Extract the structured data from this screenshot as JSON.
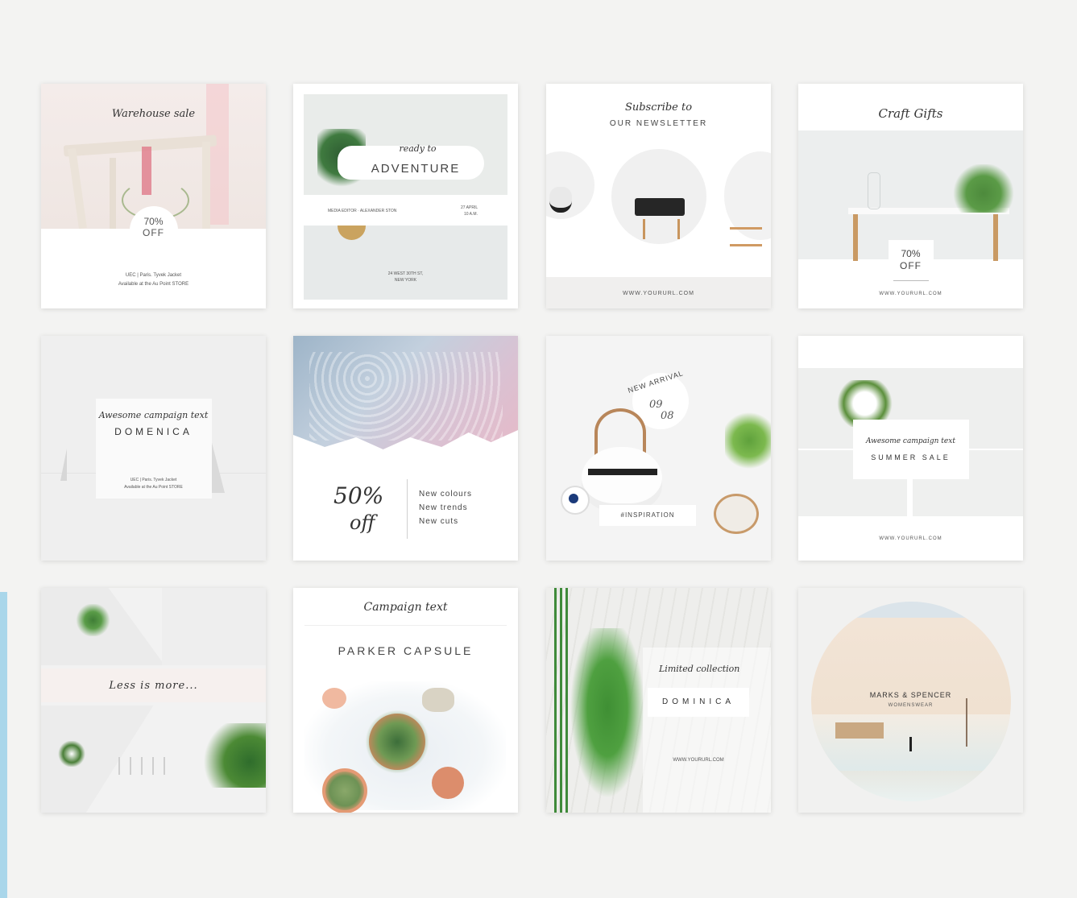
{
  "colors": {
    "background": "#f3f3f2",
    "accent_strip": "#a9d6ea",
    "card": "#ffffff"
  },
  "cards": [
    {
      "script": "Warehouse sale",
      "badge_line1": "70%",
      "badge_line2": "OFF",
      "caption_line1": "UEC | Paris. Tyvek Jacket",
      "caption_line2": "Available at the Au Point STORE"
    },
    {
      "script": "ready to",
      "heading": "ADVENTURE",
      "meta_left": "MEDIA EDITOR  ·  ALEXANDER STON",
      "meta_date": "27 APRIL",
      "meta_time": "10 A.M.",
      "address_line1": "24 WEST 30TH ST,",
      "address_line2": "NEW YORK"
    },
    {
      "script": "Subscribe to",
      "heading": "OUR NEWSLETTER",
      "url": "WWW.YOURURL.COM"
    },
    {
      "script": "Craft Gifts",
      "badge_line1": "70%",
      "badge_line2": "OFF",
      "url": "WWW.YOURURL.COM"
    },
    {
      "script": "Awesome campaign text",
      "heading": "DOMENICA",
      "caption_line1": "UEC | Paris. Tyvek Jacket",
      "caption_line2": "Available at the Au Point STORE"
    },
    {
      "big_line1": "50%",
      "big_line2": "off",
      "list": [
        "New colours",
        "New trends",
        "New cuts"
      ]
    },
    {
      "arc_text": "NEW ARRIVAL",
      "date_top": "09",
      "date_bottom": "08",
      "tag": "#INSPIRATION"
    },
    {
      "script": "Awesome campaign text",
      "heading": "SUMMER SALE",
      "url": "WWW.YOURURL.COM"
    },
    {
      "script": "Less is more..."
    },
    {
      "script": "Campaign text",
      "heading": "PARKER CAPSULE"
    },
    {
      "script": "Limited collection",
      "heading": "DOMINICA",
      "url": "WWW.YOURURL.COM"
    },
    {
      "heading": "MARKS & SPENCER",
      "subheading": "WOMENSWEAR"
    }
  ]
}
